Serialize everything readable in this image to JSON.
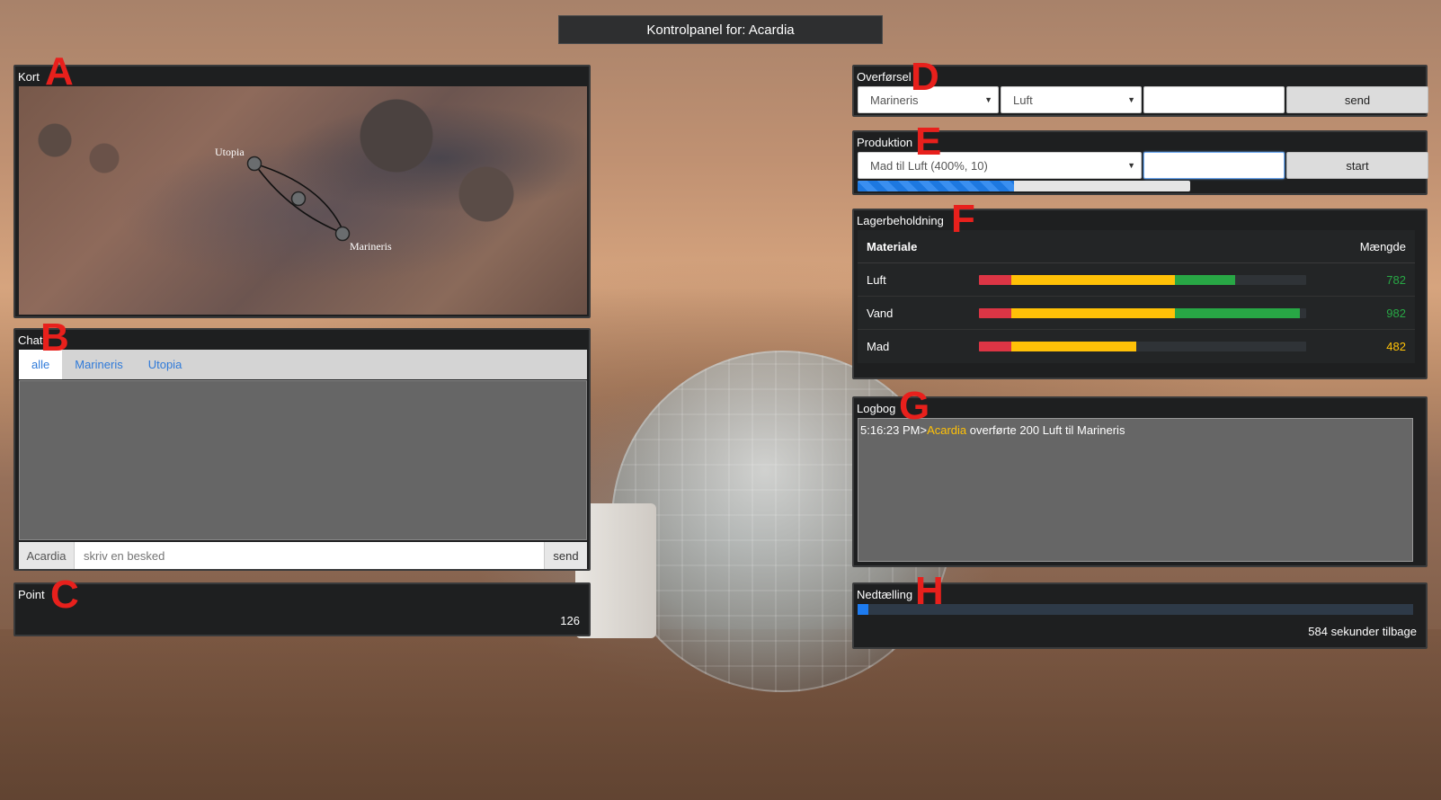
{
  "header": {
    "title": "Kontrolpanel for: Acardia"
  },
  "markers": {
    "a": "A",
    "b": "B",
    "c": "C",
    "d": "D",
    "e": "E",
    "f": "F",
    "g": "G",
    "h": "H"
  },
  "map": {
    "title": "Kort",
    "locations": [
      "Utopia",
      "Marineris"
    ]
  },
  "chat": {
    "title": "Chat",
    "tabs": [
      "alle",
      "Marineris",
      "Utopia"
    ],
    "active_tab": "alle",
    "sender": "Acardia",
    "input_placeholder": "skriv en besked",
    "send_label": "send"
  },
  "point": {
    "title": "Point",
    "value": "126"
  },
  "transfer": {
    "title": "Overførsel",
    "destination": "Marineris",
    "resource": "Luft",
    "amount_value": "",
    "send_label": "send"
  },
  "production": {
    "title": "Produktion",
    "recipe": "Mad til Luft (400%, 10)",
    "amount_value": "",
    "start_label": "start",
    "progress_fraction": 0.47
  },
  "inventory": {
    "title": "Lagerbeholdning",
    "col_material": "Materiale",
    "col_amount": "Mængde",
    "max": 1000,
    "rows": [
      {
        "name": "Luft",
        "value": "782",
        "amount": 782,
        "color": "#28a745"
      },
      {
        "name": "Vand",
        "value": "982",
        "amount": 982,
        "color": "#28a745"
      },
      {
        "name": "Mad",
        "value": "482",
        "amount": 482,
        "color": "#ffc107"
      }
    ]
  },
  "logbook": {
    "title": "Logbog",
    "entries": [
      {
        "time": "5:16:23 PM>",
        "name": "Acardia",
        "text": " overførte 200 Luft til Marineris"
      }
    ]
  },
  "countdown": {
    "title": "Nedtælling",
    "progress_fraction": 0.02,
    "text": "584 sekunder tilbage"
  },
  "colors": {
    "red": "#dc3545",
    "yellow": "#ffc107",
    "green": "#28a745",
    "blue": "#1d7bf0",
    "marker": "#e8201c"
  }
}
